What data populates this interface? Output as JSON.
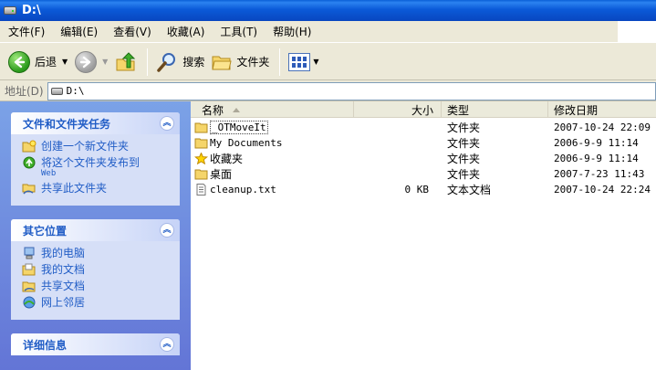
{
  "window": {
    "title": "D:\\"
  },
  "menu": [
    "文件(F)",
    "编辑(E)",
    "查看(V)",
    "收藏(A)",
    "工具(T)",
    "帮助(H)"
  ],
  "toolbar": {
    "back": "后退",
    "search": "搜索",
    "folders": "文件夹"
  },
  "address": {
    "label": "地址(D)",
    "value": "D:\\"
  },
  "taskpane": {
    "file_tasks": {
      "title": "文件和文件夹任务",
      "items": [
        "创建一个新文件夹",
        "将这个文件夹发布到",
        "共享此文件夹"
      ],
      "publish_suffix": "Web"
    },
    "other_places": {
      "title": "其它位置",
      "items": [
        "我的电脑",
        "我的文档",
        "共享文档",
        "网上邻居"
      ]
    },
    "details": {
      "title": "详细信息"
    }
  },
  "filelist": {
    "columns": {
      "name": "名称",
      "size": "大小",
      "type": "类型",
      "modified": "修改日期"
    },
    "rows": [
      {
        "name": "_OTMoveIt",
        "size": "",
        "type": "文件夹",
        "modified": "2007-10-24 22:09",
        "icon": "folder-icon"
      },
      {
        "name": "My Documents",
        "size": "",
        "type": "文件夹",
        "modified": "2006-9-9 11:14",
        "icon": "folder-icon"
      },
      {
        "name": "收藏夹",
        "size": "",
        "type": "文件夹",
        "modified": "2006-9-9 11:14",
        "icon": "favorites-star-icon"
      },
      {
        "name": "桌面",
        "size": "",
        "type": "文件夹",
        "modified": "2007-7-23 11:43",
        "icon": "folder-icon"
      },
      {
        "name": "cleanup.txt",
        "size": "0 KB",
        "type": "文本文档",
        "modified": "2007-10-24 22:24",
        "icon": "text-file-icon"
      }
    ]
  }
}
